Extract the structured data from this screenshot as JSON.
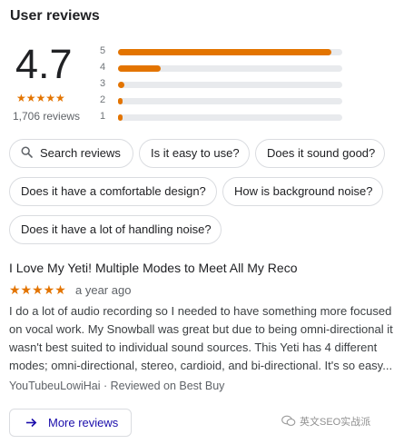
{
  "header": {
    "title": "User reviews"
  },
  "summary": {
    "rating": "4.7",
    "stars_display": "★★★★★",
    "rating_value": 4.7,
    "review_count": "1,706 reviews"
  },
  "histogram": [
    {
      "label": "5",
      "fraction": 0.95
    },
    {
      "label": "4",
      "fraction": 0.19
    },
    {
      "label": "3",
      "fraction": 0.03
    },
    {
      "label": "2",
      "fraction": 0.02
    },
    {
      "label": "1",
      "fraction": 0.02
    }
  ],
  "chips": [
    {
      "label": "Search reviews",
      "icon": "search-icon"
    },
    {
      "label": "Is it easy to use?"
    },
    {
      "label": "Does it sound good?"
    },
    {
      "label": "Does it have a comfortable design?"
    },
    {
      "label": "How is background noise?"
    },
    {
      "label": "Does it have a lot of handling noise?"
    }
  ],
  "review": {
    "title": "I Love My Yeti! Multiple Modes to Meet All My Reco",
    "stars": "★★★★★",
    "time": "a year ago",
    "body": "I do a lot of audio recording so I needed to have something more focused on vocal work. My Snowball was great but due to being omni-directional it wasn't best suited to individual sound sources. This Yeti has 4 different modes; omni-directional, stereo, cardioid, and bi-directional. It's so easy...",
    "meta": "YouTubeuLowiHai · Reviewed on Best Buy"
  },
  "more_button": {
    "label": "More reviews",
    "icon": "arrow-right-icon"
  },
  "watermark": {
    "text": "英文SEO实战派",
    "icon": "wechat-icon"
  },
  "colors": {
    "accent": "#e37400",
    "link": "#1a0dab",
    "track": "#e8eaed"
  }
}
